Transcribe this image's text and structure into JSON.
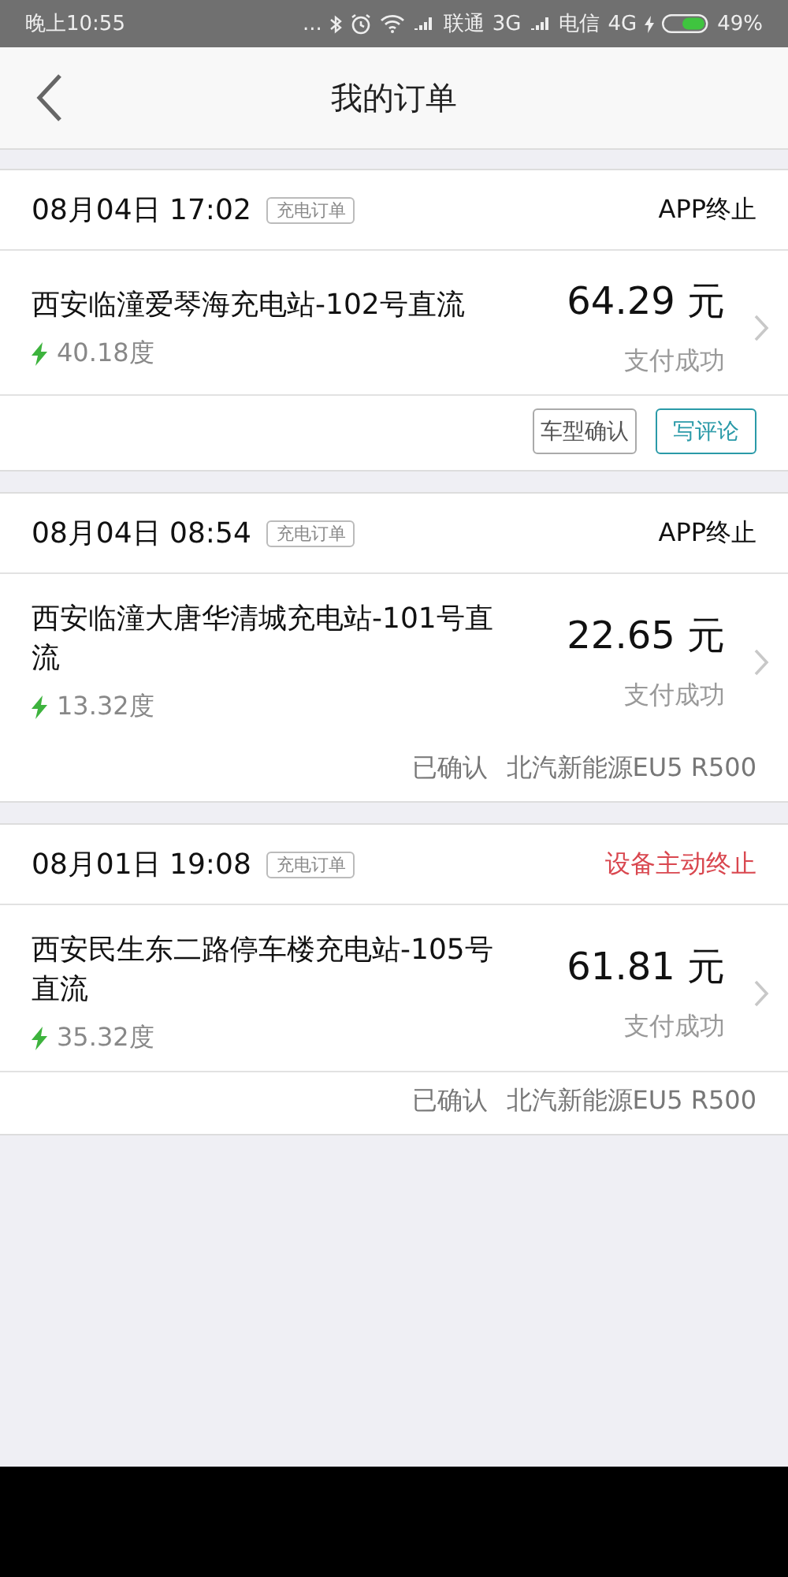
{
  "status_bar": {
    "time": "晚上10:55",
    "dots": "...",
    "carrier_1": "联通",
    "network_1": "3G",
    "carrier_2": "电信",
    "network_2": "4G",
    "battery": "49%"
  },
  "header": {
    "title": "我的订单"
  },
  "orders": [
    {
      "date": "08月04日 17:02",
      "tag": "充电订单",
      "status": "APP终止",
      "alert": false,
      "station": "西安临潼爱琴海充电站-102号直流",
      "energy": "40.18度",
      "amount": "64.29 元",
      "payment": "支付成功",
      "footer": {
        "kind": "buttons",
        "divider": true,
        "buttons": [
          {
            "label": "车型确认",
            "highlighted": false
          },
          {
            "label": "写评论",
            "highlighted": true
          }
        ]
      }
    },
    {
      "date": "08月04日 08:54",
      "tag": "充电订单",
      "status": "APP终止",
      "alert": false,
      "station": "西安临潼大唐华清城充电站-101号直流",
      "energy": "13.32度",
      "amount": "22.65 元",
      "payment": "支付成功",
      "footer": {
        "kind": "confirmed",
        "divider": false,
        "state": "已确认",
        "car": "北汽新能源EU5 R500"
      }
    },
    {
      "date": "08月01日 19:08",
      "tag": "充电订单",
      "status": "设备主动终止",
      "alert": true,
      "station": "西安民生东二路停车楼充电站-105号直流",
      "energy": "35.32度",
      "amount": "61.81 元",
      "payment": "支付成功",
      "footer": {
        "kind": "confirmed",
        "divider": true,
        "state": "已确认",
        "car": "北汽新能源EU5 R500"
      }
    }
  ]
}
